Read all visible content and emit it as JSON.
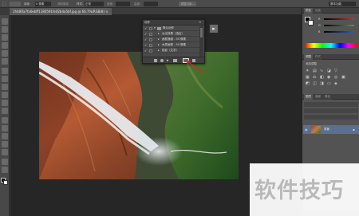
{
  "options_bar": {
    "feather_label": "羽化:",
    "feather_value": "0 像素",
    "antialias_label": "消除锯齿",
    "style_label": "样式:",
    "style_value": "正常",
    "width_label": "宽度:",
    "height_label": "高度:",
    "refine_edge_label": "调整边缘...",
    "workspace_value": "基本功能"
  },
  "document": {
    "tab_title": "1f4d6fa7fa0ebff1180591fe02b4a5bf.jpg @ 66.7%(RGB/8) ×"
  },
  "actions_panel": {
    "title": "动作",
    "items": [
      {
        "label": "默认动作",
        "checked": true,
        "expanded": true
      },
      {
        "label": "淡出效果（选区）",
        "checked": true
      },
      {
        "label": "画框通道 - 50 像素",
        "checked": true
      },
      {
        "label": "木质画框 - 50 像素",
        "checked": true
      },
      {
        "label": "投影（文字）",
        "checked": true
      }
    ]
  },
  "right_panel": {
    "color_tabs": [
      "颜色",
      "色板"
    ],
    "slider_labels": [
      "R",
      "G",
      "B"
    ],
    "slider_values": [
      "",
      "",
      ""
    ],
    "adjust_tabs": [
      "调整",
      "样式"
    ],
    "adjust_subtitle": "添加调整",
    "layers_tabs": [
      "图层",
      "通道",
      "路径"
    ],
    "layer_name": "背景",
    "colors": {
      "red": "#d9282a",
      "green": "#3ca34a",
      "blue": "#2d5bc7"
    }
  },
  "watermark": {
    "text": "软件技巧"
  }
}
